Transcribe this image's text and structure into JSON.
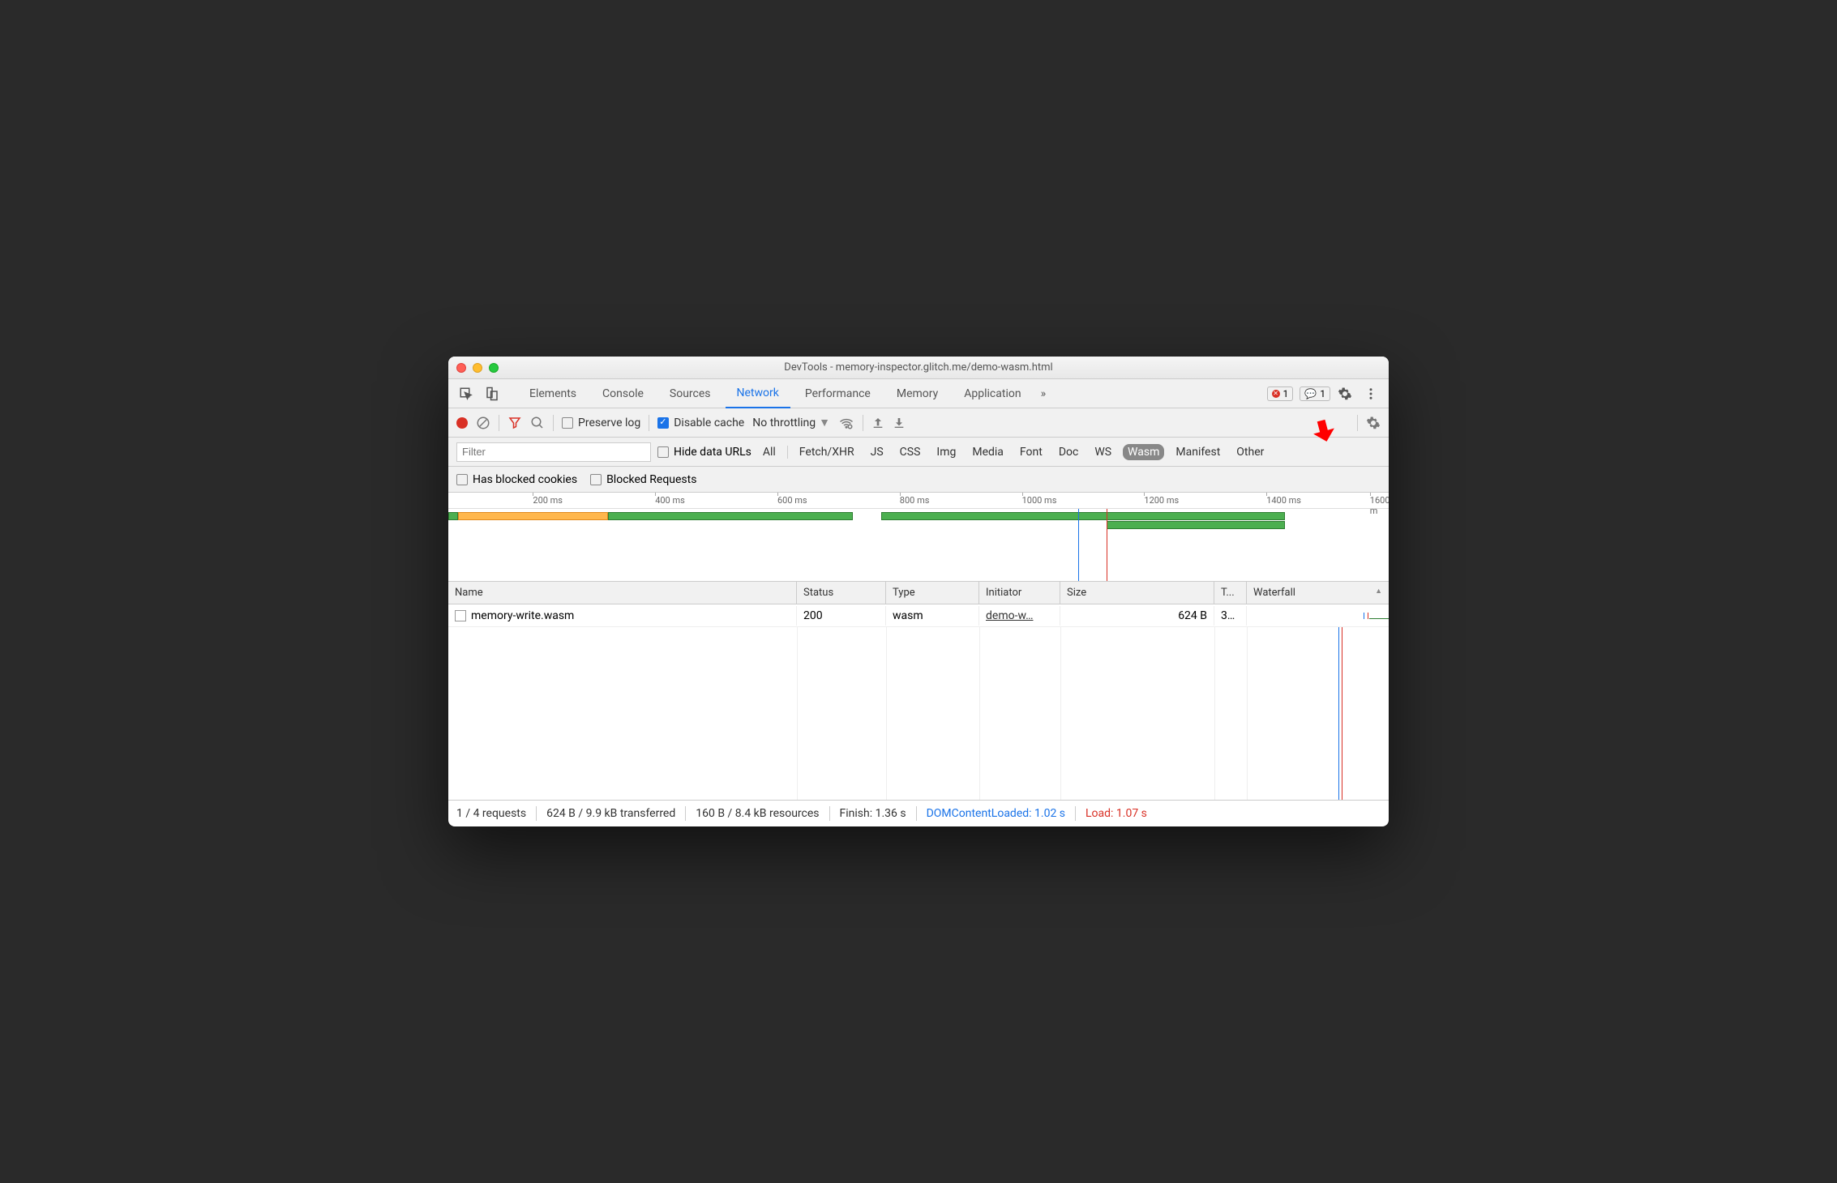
{
  "window": {
    "title": "DevTools - memory-inspector.glitch.me/demo-wasm.html"
  },
  "tabs": {
    "items": [
      "Elements",
      "Console",
      "Sources",
      "Network",
      "Performance",
      "Memory",
      "Application"
    ],
    "active": "Network",
    "more": "»",
    "error_count": "1",
    "message_count": "1"
  },
  "toolbar": {
    "preserve_log": "Preserve log",
    "disable_cache": "Disable cache",
    "throttling": "No throttling"
  },
  "filterbar": {
    "filter_placeholder": "Filter",
    "hide_data_urls": "Hide data URLs",
    "types": [
      "All",
      "Fetch/XHR",
      "JS",
      "CSS",
      "Img",
      "Media",
      "Font",
      "Doc",
      "WS",
      "Wasm",
      "Manifest",
      "Other"
    ],
    "active_type": "Wasm",
    "has_blocked_cookies": "Has blocked cookies",
    "blocked_requests": "Blocked Requests"
  },
  "timeline": {
    "ticks": [
      "200 ms",
      "400 ms",
      "600 ms",
      "800 ms",
      "1000 ms",
      "1200 ms",
      "1400 ms",
      "1600 m"
    ]
  },
  "table": {
    "headers": {
      "name": "Name",
      "status": "Status",
      "type": "Type",
      "initiator": "Initiator",
      "size": "Size",
      "time": "T...",
      "waterfall": "Waterfall"
    },
    "rows": [
      {
        "name": "memory-write.wasm",
        "status": "200",
        "type": "wasm",
        "initiator": "demo-w…",
        "size": "624 B",
        "time": "3…"
      }
    ]
  },
  "summary": {
    "requests": "1 / 4 requests",
    "transferred": "624 B / 9.9 kB transferred",
    "resources": "160 B / 8.4 kB resources",
    "finish": "Finish: 1.36 s",
    "dcl": "DOMContentLoaded: 1.02 s",
    "load": "Load: 1.07 s"
  }
}
